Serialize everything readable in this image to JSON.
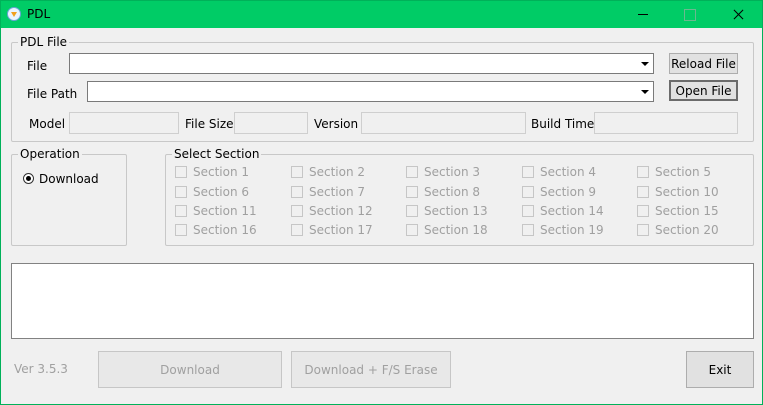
{
  "window": {
    "title": "PDL"
  },
  "pdl_file": {
    "group_label": "PDL File",
    "file_label": "File",
    "file_value": "",
    "file_path_label": "File Path",
    "file_path_value": "",
    "reload_label": "Reload File",
    "open_label": "Open File",
    "model_label": "Model",
    "file_size_label": "File Size",
    "version_label": "Version",
    "build_time_label": "Build Time",
    "model_value": "",
    "file_size_value": "",
    "version_value": "",
    "build_time_value": ""
  },
  "operation": {
    "group_label": "Operation",
    "download_label": "Download",
    "selected": "Download"
  },
  "select_section": {
    "group_label": "Select Section",
    "items": [
      "Section 1",
      "Section 2",
      "Section 3",
      "Section 4",
      "Section 5",
      "Section 6",
      "Section 7",
      "Section 8",
      "Section 9",
      "Section 10",
      "Section 11",
      "Section 12",
      "Section 13",
      "Section 14",
      "Section 15",
      "Section 16",
      "Section 17",
      "Section 18",
      "Section 19",
      "Section 20"
    ]
  },
  "footer": {
    "version_text": "Ver 3.5.3",
    "download_label": "Download",
    "download_erase_label": "Download + F/S Erase",
    "exit_label": "Exit"
  },
  "colors": {
    "titlebar": "#00cc66",
    "window_bg": "#f0f0f0",
    "disabled_text": "#a0a0a0"
  }
}
